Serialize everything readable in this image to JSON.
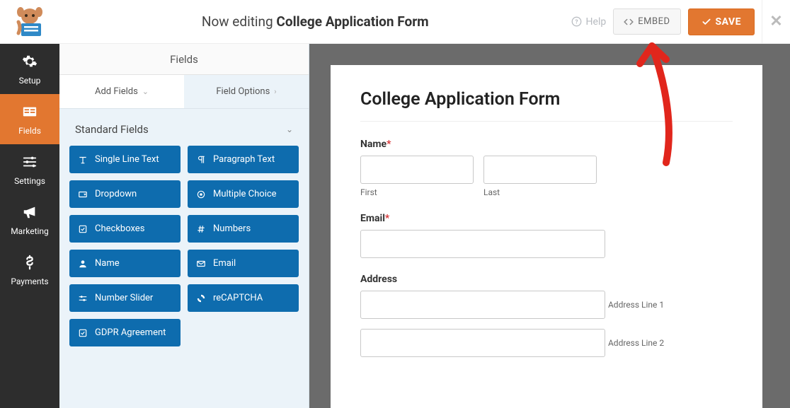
{
  "topbar": {
    "editing_prefix": "Now editing ",
    "form_name": "College Application Form",
    "help": "Help",
    "embed": "EMBED",
    "save": "SAVE"
  },
  "sidenav": {
    "setup": "Setup",
    "fields": "Fields",
    "settings": "Settings",
    "marketing": "Marketing",
    "payments": "Payments"
  },
  "panel": {
    "header": "Fields",
    "tab_add": "Add Fields",
    "tab_options": "Field Options",
    "group_standard": "Standard Fields",
    "buttons": {
      "single_line": "Single Line Text",
      "paragraph": "Paragraph Text",
      "dropdown": "Dropdown",
      "multiple_choice": "Multiple Choice",
      "checkboxes": "Checkboxes",
      "numbers": "Numbers",
      "name": "Name",
      "email": "Email",
      "number_slider": "Number Slider",
      "recaptcha": "reCAPTCHA",
      "gdpr": "GDPR Agreement"
    }
  },
  "preview": {
    "title": "College Application Form",
    "name_label": "Name",
    "first_sub": "First",
    "last_sub": "Last",
    "email_label": "Email",
    "address_label": "Address",
    "addr1_sub": "Address Line 1",
    "addr2_sub": "Address Line 2"
  }
}
